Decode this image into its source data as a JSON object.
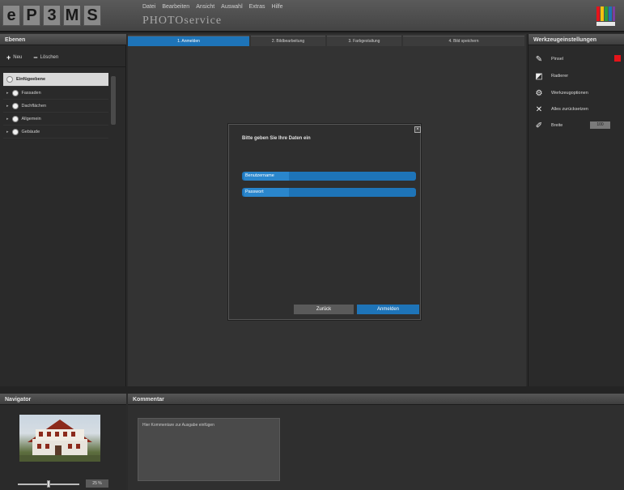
{
  "header": {
    "logo_letters": [
      "e",
      "P",
      "3",
      "M",
      "S"
    ],
    "menu": [
      "Datei",
      "Bearbeiten",
      "Ansicht",
      "Auswahl",
      "Extras",
      "Hilfe"
    ],
    "subtitle": "PHOTOservice"
  },
  "left_panel": {
    "title": "Ebenen",
    "add_label": "Neu",
    "remove_label": "Löschen",
    "tree": [
      {
        "label": "Einfügeebene",
        "selected": true
      },
      {
        "label": "Fassaden",
        "selected": false
      },
      {
        "label": "Dachflächen",
        "selected": false
      },
      {
        "label": "Allgemein",
        "selected": false
      },
      {
        "label": "Gebäude",
        "selected": false
      }
    ]
  },
  "tabs": [
    {
      "label": "1. Anmelden",
      "active": true
    },
    {
      "label": "2. Bildbearbeitung",
      "active": false
    },
    {
      "label": "3. Farbgestaltung",
      "active": false
    },
    {
      "label": "4. Bild speichern",
      "active": false
    }
  ],
  "dialog": {
    "message": "Bitte geben Sie Ihre Daten ein",
    "close_symbol": "×",
    "fields": [
      {
        "label": "Benutzername",
        "value": ""
      },
      {
        "label": "Passwort",
        "value": ""
      }
    ],
    "cancel_label": "Zurück",
    "ok_label": "Anmelden"
  },
  "right_panel": {
    "title": "Werkzeugeinstellungen",
    "tools": [
      {
        "icon": "brush-icon",
        "glyph": "✎",
        "label": "Pinsel"
      },
      {
        "icon": "eraser-icon",
        "glyph": "◩",
        "label": "Radierer"
      },
      {
        "icon": "gear-icon",
        "glyph": "⚙",
        "label": "Werkzeugoptionen"
      },
      {
        "icon": "close-icon",
        "glyph": "✕",
        "label": "Alles zurücksetzen"
      },
      {
        "icon": "pen-icon",
        "glyph": "✐",
        "label": "Breite"
      }
    ],
    "brush_color": "#e5141a",
    "width_value": "100"
  },
  "navigator": {
    "title": "Navigator",
    "zoom": "25 %"
  },
  "comment": {
    "title": "Kommentar",
    "placeholder": "Hier Kommentare zur Ausgabe einfügen"
  }
}
